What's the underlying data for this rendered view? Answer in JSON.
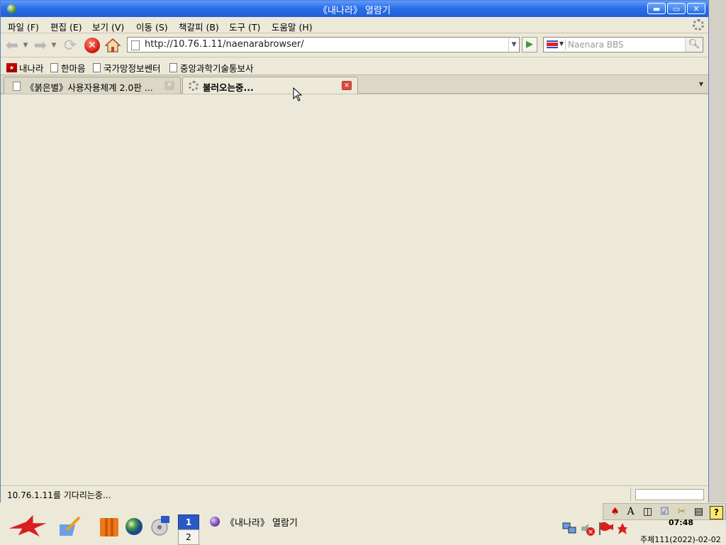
{
  "window": {
    "title": "《내나라》 열람기"
  },
  "menubar": {
    "items": [
      "파일 (F)",
      "편집 (E)",
      "보기 (V)",
      "이동 (S)",
      "책갈피 (B)",
      "도구 (T)",
      "도움말 (H)"
    ]
  },
  "navbar": {
    "url": "http://10.76.1.11/naenarabrowser/",
    "search_placeholder": "Naenara BBS",
    "icons": [
      "back-arrow-icon",
      "forward-arrow-icon",
      "reload-icon",
      "stop-icon",
      "home-icon",
      "go-arrow-icon",
      "search-magnifier-icon"
    ]
  },
  "bookmarks": {
    "items": [
      "내나라",
      "한마음",
      "국가망정보쎈터",
      "중앙과학기술통보사"
    ]
  },
  "tabs": [
    {
      "label": "《붉은별》사용자용체계 2.0판 ...",
      "active": false
    },
    {
      "label": "불러오는중...",
      "active": true
    }
  ],
  "status": {
    "text": "10.76.1.11를 기다리는중..."
  },
  "taskbar": {
    "desktops": [
      "1",
      "2"
    ],
    "task_label": "《내나라》 열람기",
    "clock": "07:48",
    "date": "주체111(2022)-02-02",
    "tray_icons": [
      "keyboard-icon",
      "font-icon",
      "window-icon",
      "notes-icon",
      "tools-icon",
      "clipboard-icon",
      "help-icon"
    ],
    "launch_icons": [
      "red-star-start-icon",
      "editor-icon",
      "files-icon",
      "browser-globe-icon",
      "music-icon"
    ]
  }
}
